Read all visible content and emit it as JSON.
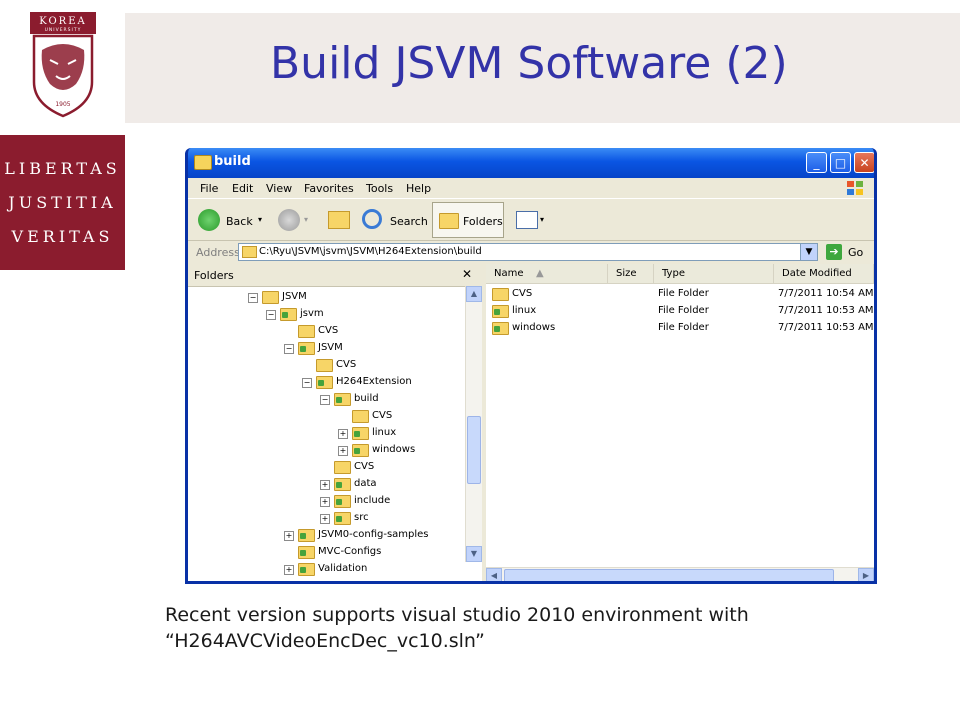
{
  "slide": {
    "title": "Build JSVM Software (2)",
    "motto": [
      "LIBERTAS",
      "JUSTITIA",
      "VERITAS"
    ],
    "logo": {
      "name": "KOREA",
      "sub": "UNIVERSITY",
      "year": "1905"
    },
    "caption_line1": "Recent version supports visual studio 2010 environment with",
    "caption_line2": "“H264AVCVideoEncDec_vc10.sln”",
    "colors": {
      "maroon": "#8b1c2e",
      "title_blue": "#3333a8",
      "header_band": "#f0ebe8"
    }
  },
  "window": {
    "title": "build",
    "controls": {
      "minimize": "_",
      "maximize": "□",
      "close": "✕"
    },
    "menu": [
      "File",
      "Edit",
      "View",
      "Favorites",
      "Tools",
      "Help"
    ],
    "toolbar": {
      "back": "Back",
      "search": "Search",
      "folders": "Folders"
    },
    "address": {
      "label": "Address",
      "value": "C:\\Ryu\\JSVM\\jsvm\\JSVM\\H264Extension\\build",
      "go": "Go"
    },
    "folders_pane": {
      "title": "Folders",
      "close": "✕",
      "tree": [
        {
          "label": "JSVM",
          "expander": "⊟",
          "shared": false
        },
        {
          "label": "jsvm",
          "expander": "⊟",
          "shared": true
        },
        {
          "label": "CVS",
          "expander": "",
          "shared": false
        },
        {
          "label": "JSVM",
          "expander": "⊟",
          "shared": true
        },
        {
          "label": "CVS",
          "expander": "",
          "shared": false
        },
        {
          "label": "H264Extension",
          "expander": "⊟",
          "shared": true
        },
        {
          "label": "build",
          "expander": "⊟",
          "shared": true
        },
        {
          "label": "CVS",
          "expander": "",
          "shared": false
        },
        {
          "label": "linux",
          "expander": "⊞",
          "shared": true
        },
        {
          "label": "windows",
          "expander": "⊞",
          "shared": true
        },
        {
          "label": "CVS",
          "expander": "",
          "shared": false
        },
        {
          "label": "data",
          "expander": "⊞",
          "shared": true
        },
        {
          "label": "include",
          "expander": "⊞",
          "shared": true
        },
        {
          "label": "src",
          "expander": "⊞",
          "shared": true
        },
        {
          "label": "JSVM0-config-samples",
          "expander": "⊞",
          "shared": true
        },
        {
          "label": "MVC-Configs",
          "expander": "",
          "shared": true
        },
        {
          "label": "Validation",
          "expander": "⊞",
          "shared": true
        }
      ]
    },
    "list": {
      "columns": [
        "Name",
        "Size",
        "Type",
        "Date Modified"
      ],
      "rows": [
        {
          "name": "CVS",
          "size": "",
          "type": "File Folder",
          "date": "7/7/2011 10:54 AM",
          "shared": false
        },
        {
          "name": "linux",
          "size": "",
          "type": "File Folder",
          "date": "7/7/2011 10:53 AM",
          "shared": true
        },
        {
          "name": "windows",
          "size": "",
          "type": "File Folder",
          "date": "7/7/2011 10:53 AM",
          "shared": true
        }
      ]
    }
  }
}
